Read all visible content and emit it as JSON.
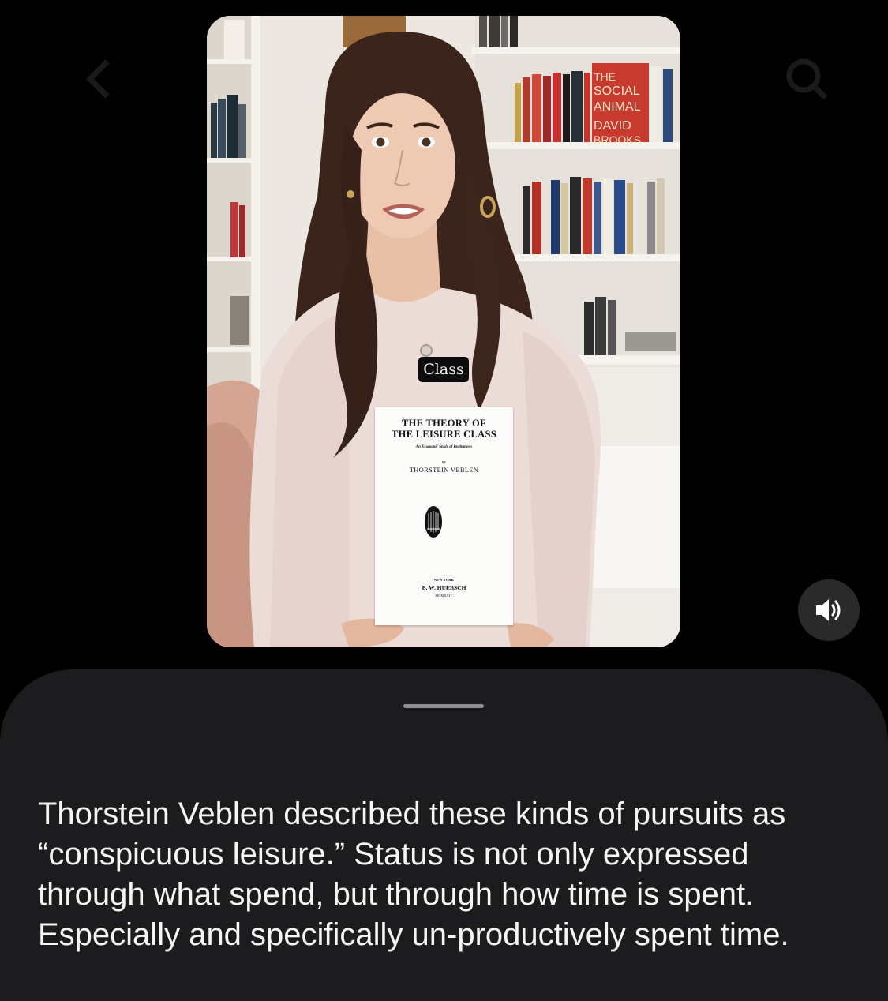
{
  "video": {
    "overlay_caption": "Class",
    "spine_text": {
      "line1": "THE",
      "line2": "SOCIAL",
      "line3": "ANIMAL",
      "line4": "DAVID",
      "line5": "BROOKS"
    },
    "book": {
      "title_line1": "THE THEORY OF",
      "title_line2": "THE LEISURE CLASS",
      "subtitle": "An Economic Study of Institutions",
      "by": "BY",
      "author": "THORSTEIN VEBLEN",
      "place": "NEW YORK",
      "publisher": "B. W. HUEBSCH",
      "year": "MCMXXIV"
    }
  },
  "controls": {
    "sound_icon": "speaker-volume-icon",
    "back_icon": "chevron-left-icon",
    "search_icon": "search-icon"
  },
  "sheet": {
    "text": "Thorstein Veblen described these kinds of pursuits as “conspicuous leisure.” Status is not only expressed through what spend, but through how time is spent. Especially and specifically un-productively spent time."
  },
  "colors": {
    "background": "#000000",
    "sheet": "#1c1c1e",
    "sheet_text": "#f5f5f5",
    "sound_button": "#2a2a2a"
  }
}
